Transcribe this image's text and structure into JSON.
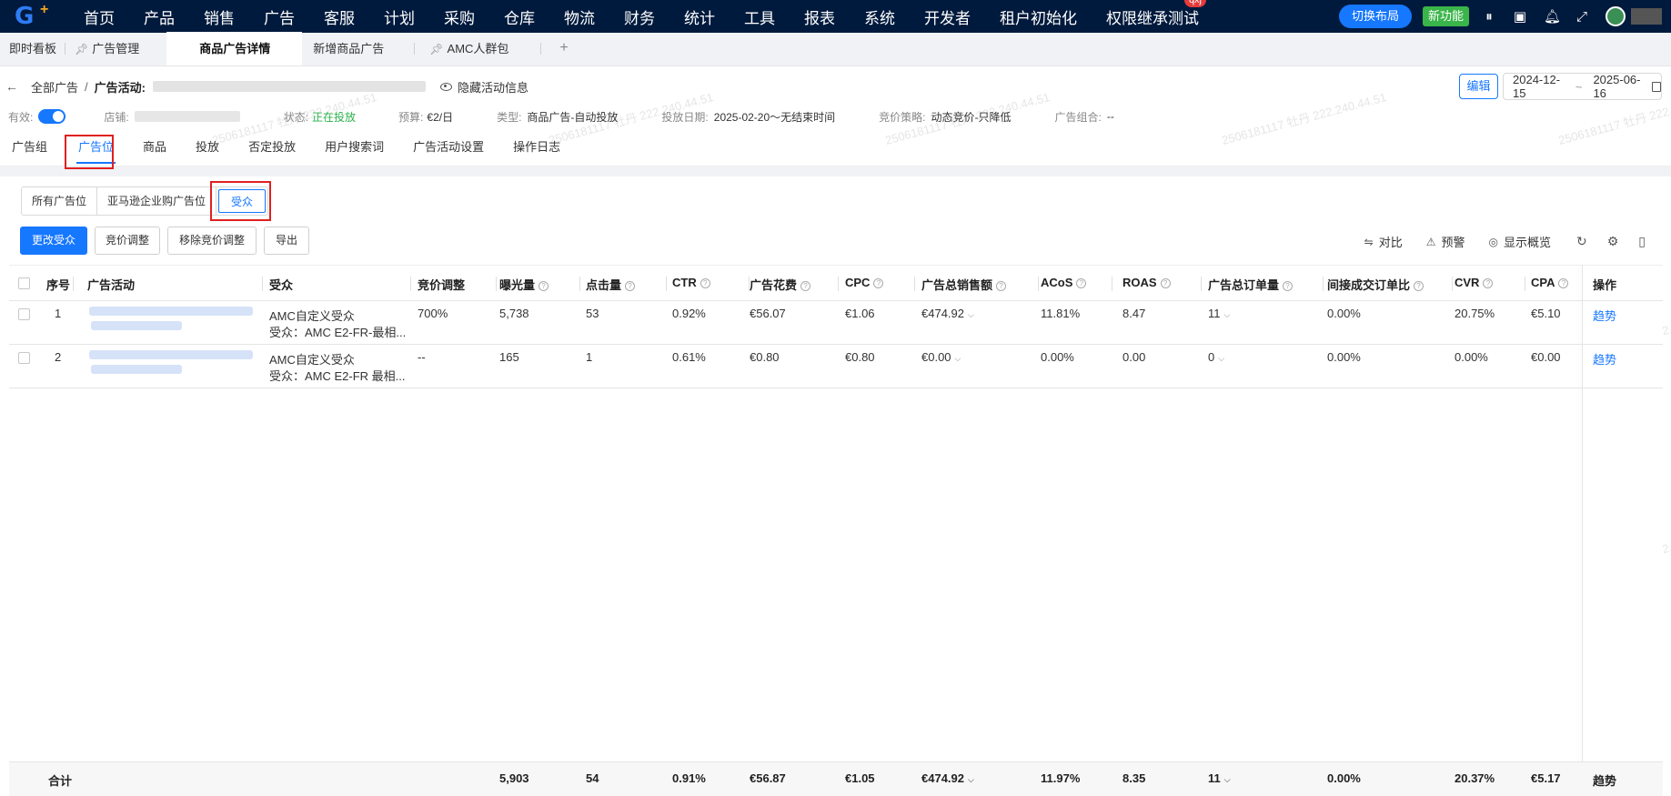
{
  "topbar": {
    "nav": [
      "首页",
      "产品",
      "销售",
      "广告",
      "客服",
      "计划",
      "采购",
      "仓库",
      "物流",
      "财务",
      "统计",
      "工具",
      "报表",
      "系统",
      "开发者",
      "租户初始化",
      "权限继承测试"
    ],
    "badge": "qxj",
    "switch_layout": "切换布局",
    "new_feature": "新功能"
  },
  "tabs": {
    "items": [
      "即时看板",
      "广告管理",
      "商品广告详情",
      "新增商品广告",
      "AMC人群包"
    ],
    "plus": "+"
  },
  "header": {
    "breadcrumb_root": "全部广告",
    "breadcrumb_sep": "/",
    "campaign_label": "广告活动:",
    "hide_info": "隐藏活动信息",
    "edit": "编辑",
    "date_start": "2024-12-15",
    "date_sep": "~",
    "date_end": "2025-06-16"
  },
  "info": {
    "enabled_label": "有效:",
    "store_label": "店铺:",
    "status_label": "状态:",
    "status_value": "正在投放",
    "budget_label": "预算:",
    "budget_value": "€2/日",
    "type_label": "类型:",
    "type_value": "商品广告-自动投放",
    "date_label": "投放日期:",
    "date_value": "2025-02-20～无结束时间",
    "bid_label": "竞价策略:",
    "bid_value": "动态竞价-只降低",
    "portfolio_label": "广告组合:",
    "portfolio_value": "--"
  },
  "subtabs": [
    "广告组",
    "广告位",
    "商品",
    "投放",
    "否定投放",
    "用户搜索词",
    "广告活动设置",
    "操作日志"
  ],
  "segments": [
    "所有广告位",
    "亚马逊企业购广告位",
    "受众"
  ],
  "actions": [
    "更改受众",
    "竞价调整",
    "移除竞价调整",
    "导出"
  ],
  "tools": {
    "compare": "对比",
    "alert": "预警",
    "overview": "显示概览"
  },
  "table": {
    "headers": {
      "index": "序号",
      "campaign": "广告活动",
      "audience": "受众",
      "bid_adj": "竞价调整",
      "impressions": "曝光量",
      "clicks": "点击量",
      "ctr": "CTR",
      "spend": "广告花费",
      "cpc": "CPC",
      "sales": "广告总销售额",
      "acos": "ACoS",
      "roas": "ROAS",
      "orders": "广告总订单量",
      "indirect": "间接成交订单比",
      "cvr": "CVR",
      "cpa": "CPA",
      "op": "操作"
    },
    "rows": [
      {
        "index": "1",
        "audience": "AMC自定义受众",
        "audience_sub": "受众：AMC E2-FR-最相...",
        "bid_adj": "700%",
        "impressions": "5,738",
        "clicks": "53",
        "ctr": "0.92%",
        "spend": "€56.07",
        "cpc": "€1.06",
        "sales": "€474.92",
        "acos": "11.81%",
        "roas": "8.47",
        "orders": "11",
        "indirect": "0.00%",
        "cvr": "20.75%",
        "cpa": "€5.10",
        "op": "趋势"
      },
      {
        "index": "2",
        "audience": "AMC自定义受众",
        "audience_sub": "受众：AMC E2-FR 最相...",
        "bid_adj": "--",
        "impressions": "165",
        "clicks": "1",
        "ctr": "0.61%",
        "spend": "€0.80",
        "cpc": "€0.80",
        "sales": "€0.00",
        "acos": "0.00%",
        "roas": "0.00",
        "orders": "0",
        "indirect": "0.00%",
        "cvr": "0.00%",
        "cpa": "€0.00",
        "op": "趋势"
      }
    ],
    "total": {
      "label": "合计",
      "impressions": "5,903",
      "clicks": "54",
      "ctr": "0.91%",
      "spend": "€56.87",
      "cpc": "€1.05",
      "sales": "€474.92",
      "acos": "11.97%",
      "roas": "8.35",
      "orders": "11",
      "indirect": "0.00%",
      "cvr": "20.37%",
      "cpa": "€5.17",
      "op": "趋势"
    }
  },
  "watermark": "2506181117 牡丹 222.240.44.51",
  "colors": {
    "primary": "#1677ff",
    "topbar": "#001a3d",
    "status_green": "#2bb34a",
    "highlight_red": "#e02020"
  }
}
